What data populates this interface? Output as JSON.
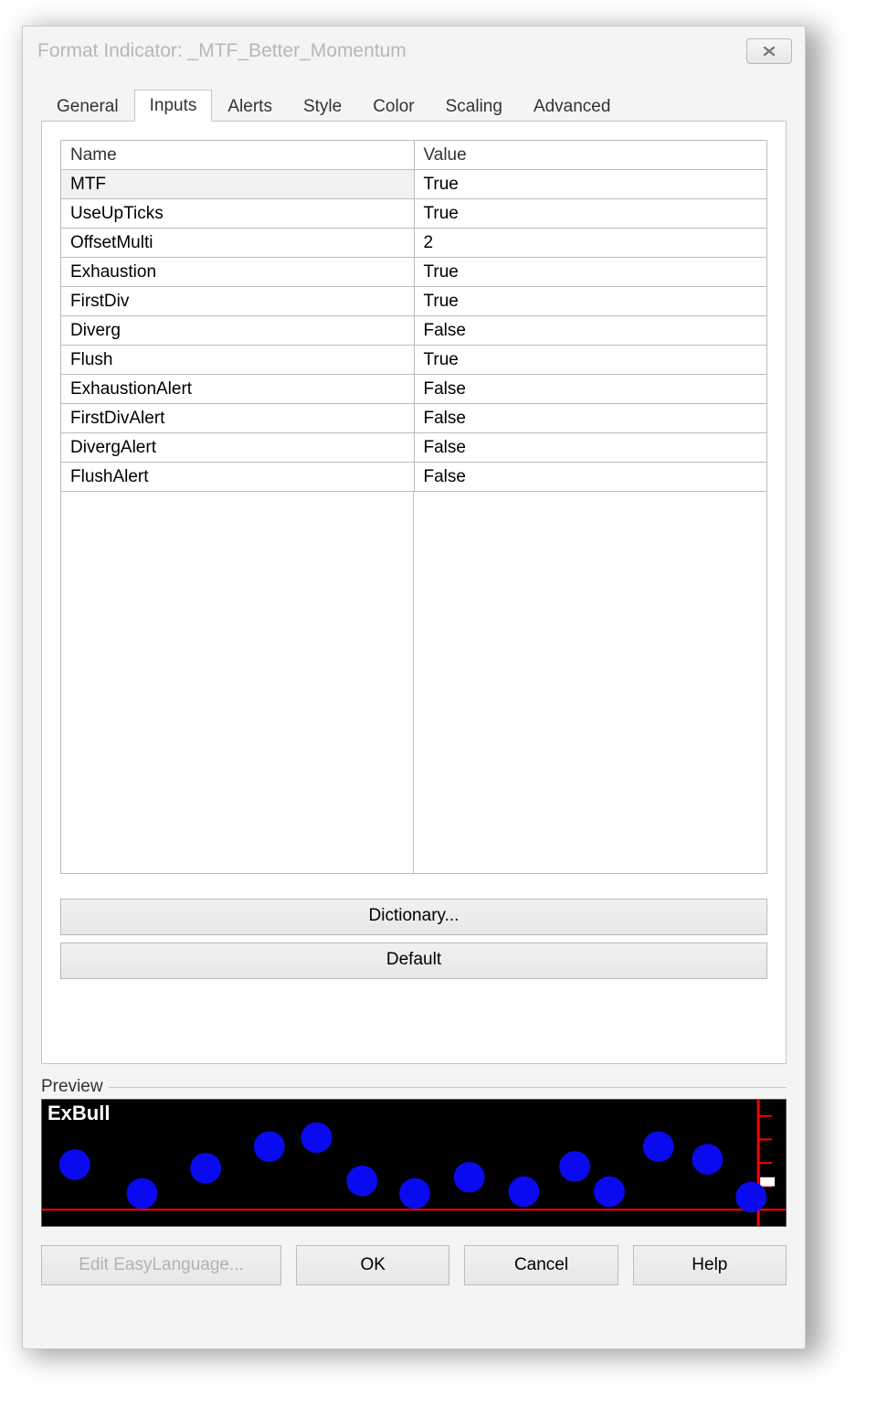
{
  "window": {
    "title": "Format Indicator: _MTF_Better_Momentum"
  },
  "tabs": [
    {
      "label": "General"
    },
    {
      "label": "Inputs"
    },
    {
      "label": "Alerts"
    },
    {
      "label": "Style"
    },
    {
      "label": "Color"
    },
    {
      "label": "Scaling"
    },
    {
      "label": "Advanced"
    }
  ],
  "active_tab": 1,
  "table": {
    "headers": {
      "name": "Name",
      "value": "Value"
    },
    "rows": [
      {
        "name": "MTF",
        "value": "True"
      },
      {
        "name": "UseUpTicks",
        "value": "True"
      },
      {
        "name": "OffsetMulti",
        "value": "2"
      },
      {
        "name": "Exhaustion",
        "value": "True"
      },
      {
        "name": "FirstDiv",
        "value": "True"
      },
      {
        "name": "Diverg",
        "value": "False"
      },
      {
        "name": "Flush",
        "value": "True"
      },
      {
        "name": "ExhaustionAlert",
        "value": "False"
      },
      {
        "name": "FirstDivAlert",
        "value": "False"
      },
      {
        "name": "DivergAlert",
        "value": "False"
      },
      {
        "name": "FlushAlert",
        "value": "False"
      }
    ]
  },
  "buttons": {
    "dictionary": "Dictionary...",
    "default": "Default"
  },
  "preview": {
    "legend": "Preview",
    "label": "ExBull"
  },
  "footer": {
    "edit_el": "Edit EasyLanguage...",
    "ok": "OK",
    "cancel": "Cancel",
    "help": "Help"
  }
}
